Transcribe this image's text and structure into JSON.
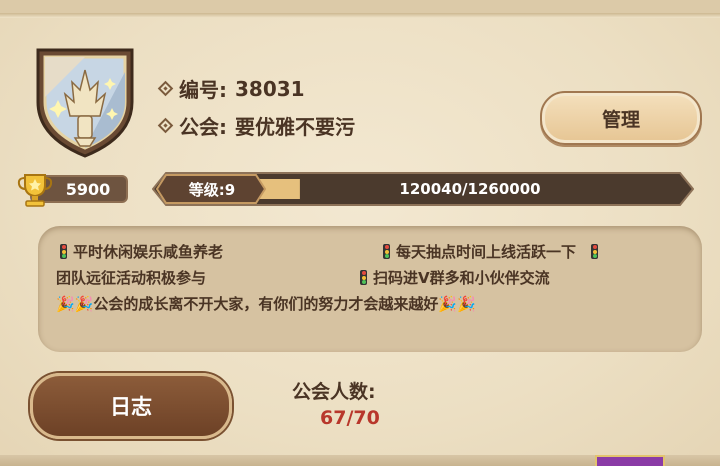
{
  "guild": {
    "id_label": "编号:",
    "id_value": "38031",
    "name_label": "公会:",
    "name_value": "要优雅不要污",
    "score": "5900"
  },
  "buttons": {
    "manage": "管理",
    "log": "日志"
  },
  "level": {
    "label": "等级:9",
    "progress_text": "120040/1260000",
    "progress_fraction": 0.095
  },
  "notice": {
    "line1_left": "平时休闲娱乐咸鱼养老",
    "line1_right": "每天抽点时间上线活跃一下",
    "line2_left": "团队远征活动积极参与",
    "line2_right": "扫码进V群多和小伙伴交流",
    "line3": "公会的成长离不开大家，有你们的努力才会越来越好"
  },
  "members": {
    "label": "公会人数:",
    "value": "67/70"
  },
  "icons": {
    "emblem": "trident-shield-icon",
    "trophy": "trophy-icon",
    "traffic_light": "traffic-light-icon",
    "party": "party-popper-icon"
  }
}
